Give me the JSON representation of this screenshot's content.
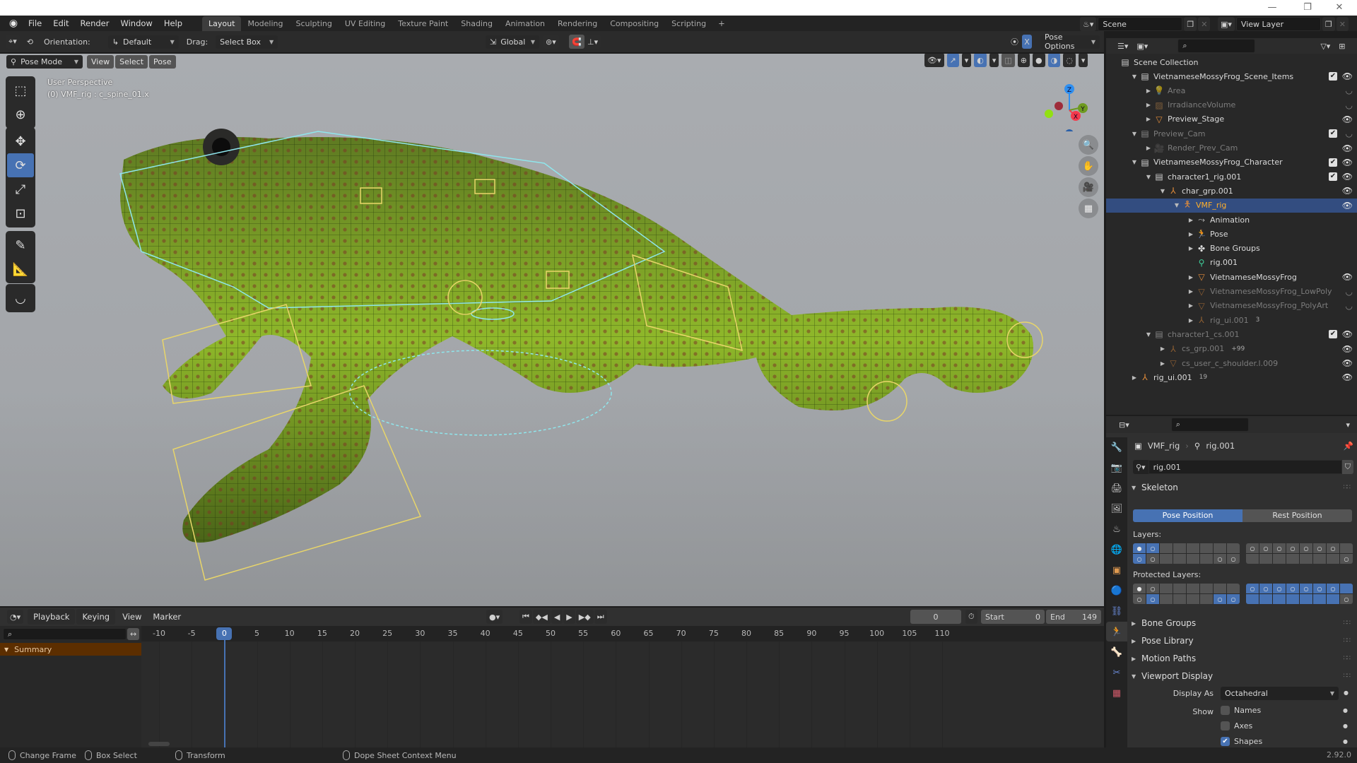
{
  "window": {
    "minimize_icon": "—",
    "maximize_icon": "❐",
    "close_icon": "✕"
  },
  "menu": {
    "items": [
      "File",
      "Edit",
      "Render",
      "Window",
      "Help"
    ],
    "workspaces": [
      "Layout",
      "Modeling",
      "Sculpting",
      "UV Editing",
      "Texture Paint",
      "Shading",
      "Animation",
      "Rendering",
      "Compositing",
      "Scripting"
    ],
    "active_workspace": "Layout",
    "add_workspace": "+",
    "scene_label": "Scene",
    "view_layer_label": "View Layer"
  },
  "tool_header": {
    "orientation_label": "Orientation:",
    "orientation_value": "Default",
    "drag_label": "Drag:",
    "drag_value": "Select Box",
    "transform_orientation": "Global",
    "pose_options": "Pose Options",
    "x_mirror": "X"
  },
  "viewport_header": {
    "mode": "Pose Mode",
    "menus": [
      "View",
      "Select",
      "Pose"
    ]
  },
  "viewport": {
    "perspective": "User Perspective",
    "active_info": "(0) VMF_rig : c_spine_01.x",
    "gizmo": {
      "z": "Z",
      "y": "Y",
      "x": "X"
    },
    "colors": {
      "x": "#f53a4c",
      "y": "#6e9a20",
      "z": "#2e8ff0",
      "background": "#a6a9ad"
    }
  },
  "outliner": {
    "root": "Scene Collection",
    "rows": [
      {
        "label": "VietnameseMossyFrog_Scene_Items",
        "level": 1,
        "arrow": "▼",
        "icon": "collection",
        "checked": true,
        "visible": true,
        "dim": false
      },
      {
        "label": "Area",
        "level": 2,
        "arrow": "▶",
        "icon": "light",
        "checked": false,
        "visible": false,
        "dim": true
      },
      {
        "label": "IrradianceVolume",
        "level": 2,
        "arrow": "▶",
        "icon": "lightprobe",
        "checked": false,
        "visible": false,
        "dim": true
      },
      {
        "label": "Preview_Stage",
        "level": 2,
        "arrow": "▶",
        "icon": "mesh",
        "checked": false,
        "visible": true,
        "dim": false
      },
      {
        "label": "Preview_Cam",
        "level": 1,
        "arrow": "▼",
        "icon": "collection",
        "checked": true,
        "visible": false,
        "dim": true
      },
      {
        "label": "Render_Prev_Cam",
        "level": 2,
        "arrow": "▶",
        "icon": "camera",
        "checked": false,
        "visible": true,
        "dim": true
      },
      {
        "label": "VietnameseMossyFrog_Character",
        "level": 1,
        "arrow": "▼",
        "icon": "collection",
        "checked": true,
        "visible": true,
        "dim": false
      },
      {
        "label": "character1_rig.001",
        "level": 2,
        "arrow": "▼",
        "icon": "collection",
        "checked": true,
        "visible": true,
        "dim": false
      },
      {
        "label": "char_grp.001",
        "level": 3,
        "arrow": "▼",
        "icon": "empty",
        "checked": false,
        "visible": true,
        "dim": false
      },
      {
        "label": "VMF_rig",
        "level": 4,
        "arrow": "▼",
        "icon": "armature",
        "checked": false,
        "visible": true,
        "dim": false,
        "selected": true
      },
      {
        "label": "Animation",
        "level": 5,
        "arrow": "▶",
        "icon": "action",
        "checked": false,
        "visible": null,
        "dim": false
      },
      {
        "label": "Pose",
        "level": 5,
        "arrow": "▶",
        "icon": "pose",
        "checked": false,
        "visible": null,
        "dim": false
      },
      {
        "label": "Bone Groups",
        "level": 5,
        "arrow": "▶",
        "icon": "bonegroup",
        "checked": false,
        "visible": null,
        "dim": false
      },
      {
        "label": "rig.001",
        "level": 5,
        "arrow": "",
        "icon": "armature-data",
        "checked": false,
        "visible": null,
        "dim": false
      },
      {
        "label": "VietnameseMossyFrog",
        "level": 5,
        "arrow": "▶",
        "icon": "mesh",
        "checked": false,
        "visible": true,
        "dim": false
      },
      {
        "label": "VietnameseMossyFrog_LowPoly",
        "level": 5,
        "arrow": "▶",
        "icon": "mesh",
        "checked": false,
        "visible": false,
        "dim": true
      },
      {
        "label": "VietnameseMossyFrog_PolyArt",
        "level": 5,
        "arrow": "▶",
        "icon": "mesh",
        "checked": false,
        "visible": false,
        "dim": true
      },
      {
        "label": "rig_ui.001",
        "level": 5,
        "arrow": "▶",
        "icon": "empty",
        "checked": false,
        "visible": null,
        "dim": true,
        "badge": "3"
      },
      {
        "label": "character1_cs.001",
        "level": 2,
        "arrow": "▼",
        "icon": "collection",
        "checked": true,
        "visible": true,
        "dim": true
      },
      {
        "label": "cs_grp.001",
        "level": 3,
        "arrow": "▶",
        "icon": "empty",
        "checked": false,
        "visible": true,
        "dim": true,
        "badge": "+99"
      },
      {
        "label": "cs_user_c_shoulder.l.009",
        "level": 3,
        "arrow": "▶",
        "icon": "mesh",
        "checked": false,
        "visible": true,
        "dim": true
      },
      {
        "label": "rig_ui.001",
        "level": 1,
        "arrow": "▶",
        "icon": "empty",
        "checked": false,
        "visible": true,
        "dim": false,
        "badge": "19"
      }
    ]
  },
  "properties": {
    "breadcrumb_object": "VMF_rig",
    "breadcrumb_data": "rig.001",
    "datablock_name": "rig.001",
    "skeleton_panel": "Skeleton",
    "pose_position": "Pose Position",
    "rest_position": "Rest Position",
    "active_position": "Pose Position",
    "layers_label": "Layers:",
    "protected_layers_label": "Protected Layers:",
    "layers": {
      "left": [
        [
          2,
          1,
          0,
          0,
          0,
          0,
          0,
          0
        ],
        [
          1,
          1,
          0,
          0,
          0,
          0,
          1,
          1
        ]
      ],
      "right": [
        [
          1,
          1,
          1,
          1,
          1,
          1,
          1,
          0
        ],
        [
          0,
          0,
          0,
          0,
          0,
          0,
          0,
          1
        ]
      ],
      "left_on": [
        [
          1,
          1,
          0,
          0,
          0,
          0,
          0,
          0
        ],
        [
          1,
          0,
          0,
          0,
          0,
          0,
          0,
          0
        ]
      ],
      "right_on": [
        [
          0,
          0,
          0,
          0,
          0,
          0,
          0,
          0
        ],
        [
          0,
          0,
          0,
          0,
          0,
          0,
          0,
          0
        ]
      ]
    },
    "protected_layers": {
      "left": [
        [
          2,
          1,
          0,
          0,
          0,
          0,
          0,
          0
        ],
        [
          1,
          1,
          0,
          0,
          0,
          0,
          1,
          1
        ]
      ],
      "right": [
        [
          1,
          1,
          1,
          1,
          1,
          1,
          1,
          0
        ],
        [
          0,
          0,
          0,
          0,
          0,
          0,
          0,
          1
        ]
      ],
      "left_on": [
        [
          0,
          0,
          0,
          0,
          0,
          0,
          0,
          0
        ],
        [
          0,
          1,
          0,
          0,
          0,
          0,
          1,
          1
        ]
      ],
      "right_on": [
        [
          1,
          1,
          1,
          1,
          1,
          1,
          1,
          1
        ],
        [
          1,
          1,
          1,
          1,
          1,
          1,
          1,
          0
        ]
      ]
    },
    "collapsed_panels": [
      "Bone Groups",
      "Pose Library",
      "Motion Paths"
    ],
    "viewport_display_panel": "Viewport Display",
    "display_as_label": "Display As",
    "display_as_value": "Octahedral",
    "show_label": "Show",
    "show_options": [
      {
        "label": "Names",
        "checked": false
      },
      {
        "label": "Axes",
        "checked": false
      },
      {
        "label": "Shapes",
        "checked": true
      }
    ],
    "tabs": [
      "tool",
      "render",
      "output",
      "view-layer",
      "scene",
      "world",
      "object",
      "modifiers",
      "constraints",
      "object-data",
      "bone",
      "bone-constraints",
      "texture"
    ],
    "active_tab": "object-data"
  },
  "timeline": {
    "menus": [
      "Playback",
      "Keying",
      "View",
      "Marker"
    ],
    "current_frame": "0",
    "start_label": "Start",
    "start_value": "0",
    "end_label": "End",
    "end_value": "149",
    "ruler_ticks": [
      "-10",
      "-5",
      "0",
      "5",
      "10",
      "15",
      "20",
      "25",
      "30",
      "35",
      "40",
      "45",
      "50",
      "55",
      "60",
      "65",
      "70",
      "75",
      "80",
      "85",
      "90",
      "95",
      "100",
      "105",
      "110"
    ],
    "channel_summary": "Summary",
    "playhead_frame": 0
  },
  "statusbar": {
    "items": [
      "Change Frame",
      "Box Select",
      "Transform",
      "Dope Sheet Context Menu"
    ],
    "version": "2.92.0"
  }
}
